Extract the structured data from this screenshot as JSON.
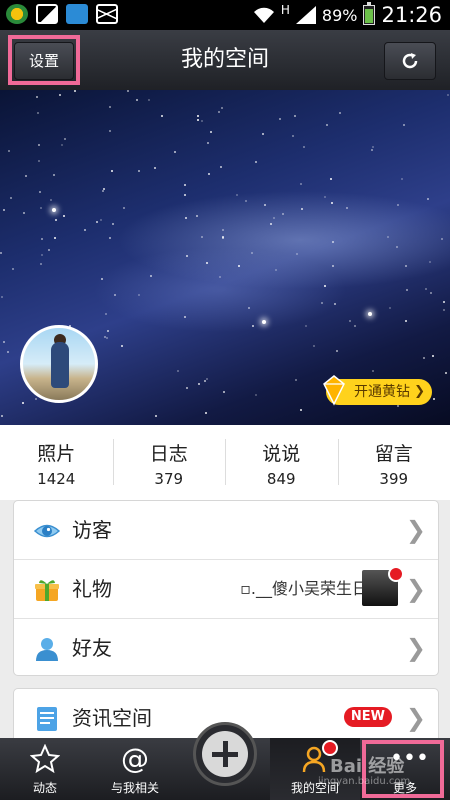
{
  "status_bar": {
    "network": "H",
    "battery": "89%",
    "battery_level": 0.89,
    "time": "21:26"
  },
  "header": {
    "settings_label": "设置",
    "title": "我的空间",
    "refresh_icon": "refresh-icon"
  },
  "cover": {
    "vip_label": "开通黄钻"
  },
  "stats": [
    {
      "label": "照片",
      "value": "1424"
    },
    {
      "label": "日志",
      "value": "379"
    },
    {
      "label": "说说",
      "value": "849"
    },
    {
      "label": "留言",
      "value": "399"
    }
  ],
  "menu": {
    "visitors": "访客",
    "gifts": "礼物",
    "gift_text": "▫.__傻小吴荣生日",
    "friends": "好友",
    "news": "资讯空间",
    "news_badge": "NEW"
  },
  "bottom_nav": {
    "feed": "动态",
    "related": "与我相关",
    "my_space": "我的空间",
    "more": "更多"
  },
  "watermark": {
    "text": "Bai 经验",
    "url": "jingyan.baidu.com"
  },
  "colors": {
    "highlight": "#f06a98",
    "vip_yellow": "#ffd21c",
    "badge_red": "#e51b23"
  }
}
